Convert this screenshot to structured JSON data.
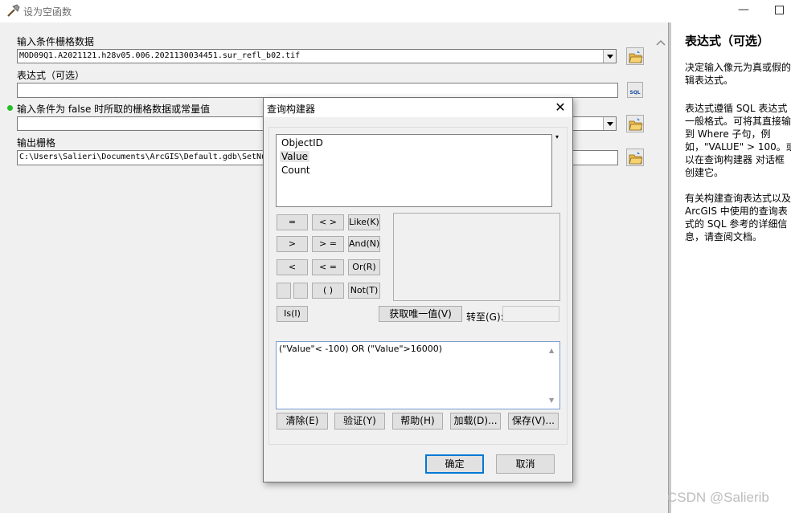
{
  "window": {
    "title": "设为空函数",
    "minimize": "—"
  },
  "form": {
    "input_raster_label": "输入条件栅格数据",
    "input_raster_value": "MOD09Q1.A2021121.h28v05.006.2021130034451.sur_refl_b02.tif",
    "expression_label": "表达式（可选）",
    "expression_value": "",
    "false_raster_label": "输入条件为 false 时所取的栅格数据或常量值",
    "false_raster_value": "",
    "output_raster_label": "输出栅格",
    "output_raster_value": "C:\\Users\\Salieri\\Documents\\ArcGIS\\Default.gdb\\SetNu",
    "sql_icon_text": "SQL"
  },
  "help": {
    "title": "表达式（可选）",
    "para1": "决定输入像元为真或假的\n辑表达式。",
    "para2": "表达式遵循 SQL 表达式\n一般格式。可将其直接输\n到 Where 子句，例\n如，\"VALUE\" > 100。或\n以在查询构建器 对话框\n创建它。",
    "para3": "有关构建查询表达式以及\nArcGIS 中使用的查询表\n式的 SQL 参考的详细信\n息，请查阅文档。"
  },
  "dialog": {
    "title": "查询构建器",
    "close": "✕",
    "fields": [
      "ObjectID",
      "Value",
      "Count"
    ],
    "operators": {
      "eq": "=",
      "ne": "< >",
      "like": "Like(K)",
      "gt": ">",
      "ge": "> =",
      "and": "And(N)",
      "lt": "<",
      "le": "< =",
      "or": "Or(R)",
      "paren": "( )",
      "not": "Not(T)",
      "is": "Is(I)"
    },
    "get_unique": "获取唯一值(V)",
    "goto_label": "转至(G):",
    "goto_value": "",
    "expression": "(\"Value\"< -100) OR (\"Value\">16000)",
    "buttons": {
      "clear": "清除(E)",
      "verify": "验证(Y)",
      "help": "帮助(H)",
      "load": "加载(D)...",
      "save": "保存(V)..."
    },
    "ok": "确定",
    "cancel": "取消"
  },
  "watermark": "CSDN @Salierib",
  "colors": {
    "ok_border": "#0078d7",
    "status_dot": "#22c022"
  }
}
